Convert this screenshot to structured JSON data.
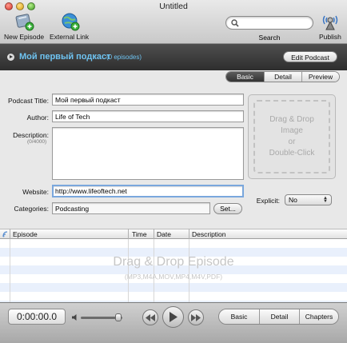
{
  "window": {
    "title": "Untitled"
  },
  "toolbar": {
    "new_episode": "New Episode",
    "external_link": "External Link",
    "search_label": "Search",
    "search_value": "",
    "publish": "Publish",
    "icons": [
      "new-episode-icon",
      "external-link-icon",
      "search-icon",
      "publish-icon"
    ]
  },
  "podcast": {
    "title": "Мой первый подкаст",
    "episode_count": "(0 episodes)",
    "edit_button": "Edit Podcast"
  },
  "view_tabs": [
    "Basic",
    "Detail",
    "Preview"
  ],
  "active_view_tab": "Basic",
  "form": {
    "podcast_title_label": "Podcast Title:",
    "podcast_title_value": "Мой первый подкаст",
    "author_label": "Author:",
    "author_value": "Life of Tech",
    "description_label": "Description:",
    "description_counter": "(0/4000)",
    "description_value": "",
    "website_label": "Website:",
    "website_value": "http://www.lifeoftech.net",
    "categories_label": "Categories:",
    "categories_value": "Podcasting",
    "set_button": "Set...",
    "explicit_label": "Explicit:",
    "explicit_value": "No"
  },
  "image_drop": {
    "line1": "Drag & Drop",
    "line2": "Image",
    "line3": "or",
    "line4": "Double-Click"
  },
  "episodes_table": {
    "columns": [
      "Episode",
      "Time",
      "Date",
      "Description"
    ],
    "rows": [],
    "drop_title": "Drag & Drop Episode",
    "drop_formats": "(MP3,M4A,MOV,MP4,M4V,PDF)"
  },
  "player": {
    "time": "0:00:00.0",
    "volume_fraction": 0.9
  },
  "bottom_tabs": [
    "Basic",
    "Detail",
    "Chapters"
  ],
  "active_bottom_tab": "Basic",
  "colors": {
    "accent_blue": "#6fc4f2",
    "header_dark": "#3a3a3a",
    "row_stripe": "#e9f0fc"
  }
}
